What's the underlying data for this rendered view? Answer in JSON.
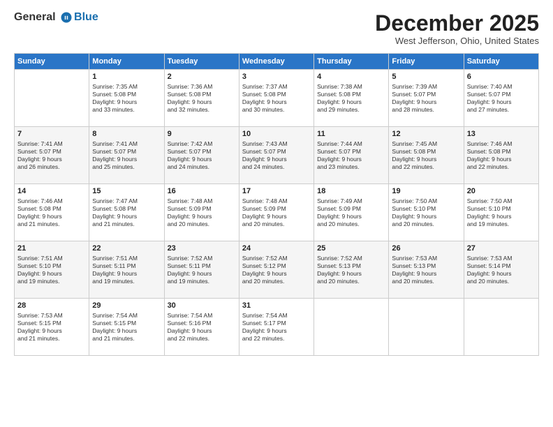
{
  "header": {
    "logo_line1": "General",
    "logo_line2": "Blue",
    "month_title": "December 2025",
    "location": "West Jefferson, Ohio, United States"
  },
  "weekdays": [
    "Sunday",
    "Monday",
    "Tuesday",
    "Wednesday",
    "Thursday",
    "Friday",
    "Saturday"
  ],
  "weeks": [
    [
      {
        "day": "",
        "info": ""
      },
      {
        "day": "1",
        "info": "Sunrise: 7:35 AM\nSunset: 5:08 PM\nDaylight: 9 hours\nand 33 minutes."
      },
      {
        "day": "2",
        "info": "Sunrise: 7:36 AM\nSunset: 5:08 PM\nDaylight: 9 hours\nand 32 minutes."
      },
      {
        "day": "3",
        "info": "Sunrise: 7:37 AM\nSunset: 5:08 PM\nDaylight: 9 hours\nand 30 minutes."
      },
      {
        "day": "4",
        "info": "Sunrise: 7:38 AM\nSunset: 5:08 PM\nDaylight: 9 hours\nand 29 minutes."
      },
      {
        "day": "5",
        "info": "Sunrise: 7:39 AM\nSunset: 5:07 PM\nDaylight: 9 hours\nand 28 minutes."
      },
      {
        "day": "6",
        "info": "Sunrise: 7:40 AM\nSunset: 5:07 PM\nDaylight: 9 hours\nand 27 minutes."
      }
    ],
    [
      {
        "day": "7",
        "info": "Sunrise: 7:41 AM\nSunset: 5:07 PM\nDaylight: 9 hours\nand 26 minutes."
      },
      {
        "day": "8",
        "info": "Sunrise: 7:41 AM\nSunset: 5:07 PM\nDaylight: 9 hours\nand 25 minutes."
      },
      {
        "day": "9",
        "info": "Sunrise: 7:42 AM\nSunset: 5:07 PM\nDaylight: 9 hours\nand 24 minutes."
      },
      {
        "day": "10",
        "info": "Sunrise: 7:43 AM\nSunset: 5:07 PM\nDaylight: 9 hours\nand 24 minutes."
      },
      {
        "day": "11",
        "info": "Sunrise: 7:44 AM\nSunset: 5:07 PM\nDaylight: 9 hours\nand 23 minutes."
      },
      {
        "day": "12",
        "info": "Sunrise: 7:45 AM\nSunset: 5:08 PM\nDaylight: 9 hours\nand 22 minutes."
      },
      {
        "day": "13",
        "info": "Sunrise: 7:46 AM\nSunset: 5:08 PM\nDaylight: 9 hours\nand 22 minutes."
      }
    ],
    [
      {
        "day": "14",
        "info": "Sunrise: 7:46 AM\nSunset: 5:08 PM\nDaylight: 9 hours\nand 21 minutes."
      },
      {
        "day": "15",
        "info": "Sunrise: 7:47 AM\nSunset: 5:08 PM\nDaylight: 9 hours\nand 21 minutes."
      },
      {
        "day": "16",
        "info": "Sunrise: 7:48 AM\nSunset: 5:09 PM\nDaylight: 9 hours\nand 20 minutes."
      },
      {
        "day": "17",
        "info": "Sunrise: 7:48 AM\nSunset: 5:09 PM\nDaylight: 9 hours\nand 20 minutes."
      },
      {
        "day": "18",
        "info": "Sunrise: 7:49 AM\nSunset: 5:09 PM\nDaylight: 9 hours\nand 20 minutes."
      },
      {
        "day": "19",
        "info": "Sunrise: 7:50 AM\nSunset: 5:10 PM\nDaylight: 9 hours\nand 20 minutes."
      },
      {
        "day": "20",
        "info": "Sunrise: 7:50 AM\nSunset: 5:10 PM\nDaylight: 9 hours\nand 19 minutes."
      }
    ],
    [
      {
        "day": "21",
        "info": "Sunrise: 7:51 AM\nSunset: 5:10 PM\nDaylight: 9 hours\nand 19 minutes."
      },
      {
        "day": "22",
        "info": "Sunrise: 7:51 AM\nSunset: 5:11 PM\nDaylight: 9 hours\nand 19 minutes."
      },
      {
        "day": "23",
        "info": "Sunrise: 7:52 AM\nSunset: 5:11 PM\nDaylight: 9 hours\nand 19 minutes."
      },
      {
        "day": "24",
        "info": "Sunrise: 7:52 AM\nSunset: 5:12 PM\nDaylight: 9 hours\nand 20 minutes."
      },
      {
        "day": "25",
        "info": "Sunrise: 7:52 AM\nSunset: 5:13 PM\nDaylight: 9 hours\nand 20 minutes."
      },
      {
        "day": "26",
        "info": "Sunrise: 7:53 AM\nSunset: 5:13 PM\nDaylight: 9 hours\nand 20 minutes."
      },
      {
        "day": "27",
        "info": "Sunrise: 7:53 AM\nSunset: 5:14 PM\nDaylight: 9 hours\nand 20 minutes."
      }
    ],
    [
      {
        "day": "28",
        "info": "Sunrise: 7:53 AM\nSunset: 5:15 PM\nDaylight: 9 hours\nand 21 minutes."
      },
      {
        "day": "29",
        "info": "Sunrise: 7:54 AM\nSunset: 5:15 PM\nDaylight: 9 hours\nand 21 minutes."
      },
      {
        "day": "30",
        "info": "Sunrise: 7:54 AM\nSunset: 5:16 PM\nDaylight: 9 hours\nand 22 minutes."
      },
      {
        "day": "31",
        "info": "Sunrise: 7:54 AM\nSunset: 5:17 PM\nDaylight: 9 hours\nand 22 minutes."
      },
      {
        "day": "",
        "info": ""
      },
      {
        "day": "",
        "info": ""
      },
      {
        "day": "",
        "info": ""
      }
    ]
  ]
}
